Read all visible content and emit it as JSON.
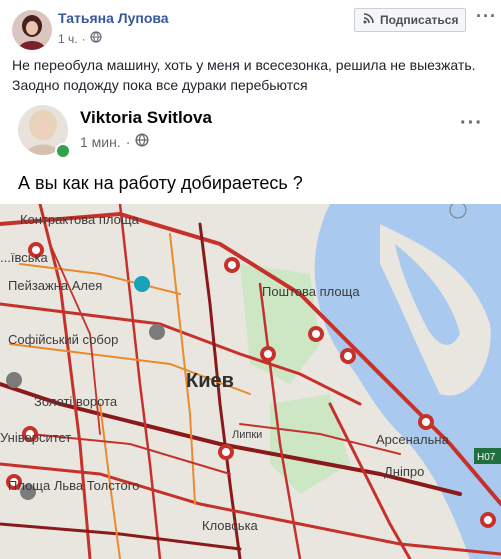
{
  "post": {
    "author": "Татьяна Лупова",
    "time": "1 ч.",
    "follow_label": "Подписаться",
    "text_line1": "Не переобула машину, хоть у меня и всесезонка, решила не выезжать.",
    "text_line2": "Заодно подожду пока все дураки перебьются"
  },
  "shared": {
    "author": "Viktoria Svitlova",
    "time": "1 мин.",
    "text": "А вы как на работу добираетесь ?"
  },
  "map": {
    "labels": {
      "kontraktova": "Контрактова площа",
      "ivska": "...ївська",
      "peizazhna": "Пейзажна Алея",
      "poshtova": "Поштова площа",
      "sofiiskyi": "Софійський собор",
      "kyiv": "Киев",
      "zoloti": "Золоті ворота",
      "universytet": "Університет",
      "lypky": "Липки",
      "arsenalna": "Арсенальна",
      "ploshcha_tolstoho": "Площа Льва Толстого",
      "dnipro": "Дніпро",
      "klovska": "Кловська",
      "h07": "H07"
    },
    "colors": {
      "water": "#a9c9ee",
      "land": "#e9e6e0",
      "park": "#cde6c4",
      "traffic_red": "#c5322b",
      "traffic_dark": "#8a1a1a",
      "traffic_orange": "#ea8a2e"
    }
  }
}
